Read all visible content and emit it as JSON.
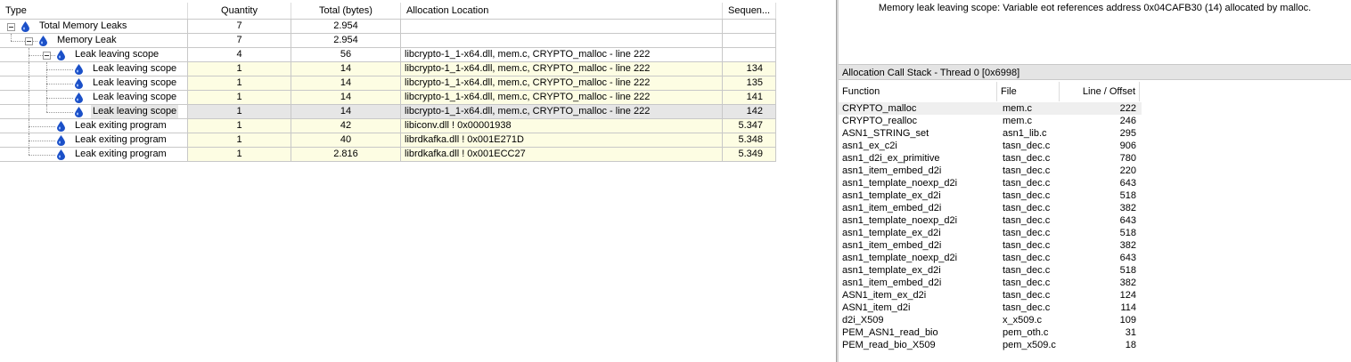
{
  "columns": {
    "type": "Type",
    "quantity": "Quantity",
    "total": "Total (bytes)",
    "location": "Allocation Location",
    "sequence": "Sequen..."
  },
  "rows": [
    {
      "label": "Total Memory Leaks",
      "quantity": "7",
      "total": "2.954",
      "location": "",
      "sequence": "",
      "highlight": false,
      "selected": false,
      "level": 0
    },
    {
      "label": "Memory Leak",
      "quantity": "7",
      "total": "2.954",
      "location": "",
      "sequence": "",
      "highlight": false,
      "selected": false,
      "level": 1
    },
    {
      "label": "Leak leaving scope",
      "quantity": "4",
      "total": "56",
      "location": "libcrypto-1_1-x64.dll, mem.c, CRYPTO_malloc - line 222",
      "sequence": "",
      "highlight": false,
      "selected": false,
      "level": 2
    },
    {
      "label": "Leak leaving scope",
      "quantity": "1",
      "total": "14",
      "location": "libcrypto-1_1-x64.dll, mem.c, CRYPTO_malloc - line 222",
      "sequence": "134",
      "highlight": true,
      "selected": false,
      "level": 3
    },
    {
      "label": "Leak leaving scope",
      "quantity": "1",
      "total": "14",
      "location": "libcrypto-1_1-x64.dll, mem.c, CRYPTO_malloc - line 222",
      "sequence": "135",
      "highlight": true,
      "selected": false,
      "level": 3
    },
    {
      "label": "Leak leaving scope",
      "quantity": "1",
      "total": "14",
      "location": "libcrypto-1_1-x64.dll, mem.c, CRYPTO_malloc - line 222",
      "sequence": "141",
      "highlight": true,
      "selected": false,
      "level": 3
    },
    {
      "label": "Leak leaving scope",
      "quantity": "1",
      "total": "14",
      "location": "libcrypto-1_1-x64.dll, mem.c, CRYPTO_malloc - line 222",
      "sequence": "142",
      "highlight": false,
      "selected": true,
      "level": 3
    },
    {
      "label": "Leak exiting program",
      "quantity": "1",
      "total": "42",
      "location": "libiconv.dll ! 0x00001938",
      "sequence": "5.347",
      "highlight": true,
      "selected": false,
      "level": 2
    },
    {
      "label": "Leak exiting program",
      "quantity": "1",
      "total": "40",
      "location": "librdkafka.dll ! 0x001E271D",
      "sequence": "5.348",
      "highlight": true,
      "selected": false,
      "level": 2
    },
    {
      "label": "Leak exiting program",
      "quantity": "1",
      "total": "2.816",
      "location": "librdkafka.dll ! 0x001ECC27",
      "sequence": "5.349",
      "highlight": true,
      "selected": false,
      "level": 2
    }
  ],
  "details": {
    "message": "Memory leak leaving scope: Variable eot references address 0x04CAFB30 (14) allocated by malloc."
  },
  "call_stack": {
    "title": "Allocation Call Stack - Thread 0 [0x6998]",
    "columns": {
      "function": "Function",
      "file": "File",
      "line": "Line / Offset"
    },
    "frames": [
      {
        "function": "CRYPTO_malloc",
        "file": "mem.c",
        "line": "222"
      },
      {
        "function": "CRYPTO_realloc",
        "file": "mem.c",
        "line": "246"
      },
      {
        "function": "ASN1_STRING_set",
        "file": "asn1_lib.c",
        "line": "295"
      },
      {
        "function": "asn1_ex_c2i",
        "file": "tasn_dec.c",
        "line": "906"
      },
      {
        "function": "asn1_d2i_ex_primitive",
        "file": "tasn_dec.c",
        "line": "780"
      },
      {
        "function": "asn1_item_embed_d2i",
        "file": "tasn_dec.c",
        "line": "220"
      },
      {
        "function": "asn1_template_noexp_d2i",
        "file": "tasn_dec.c",
        "line": "643"
      },
      {
        "function": "asn1_template_ex_d2i",
        "file": "tasn_dec.c",
        "line": "518"
      },
      {
        "function": "asn1_item_embed_d2i",
        "file": "tasn_dec.c",
        "line": "382"
      },
      {
        "function": "asn1_template_noexp_d2i",
        "file": "tasn_dec.c",
        "line": "643"
      },
      {
        "function": "asn1_template_ex_d2i",
        "file": "tasn_dec.c",
        "line": "518"
      },
      {
        "function": "asn1_item_embed_d2i",
        "file": "tasn_dec.c",
        "line": "382"
      },
      {
        "function": "asn1_template_noexp_d2i",
        "file": "tasn_dec.c",
        "line": "643"
      },
      {
        "function": "asn1_template_ex_d2i",
        "file": "tasn_dec.c",
        "line": "518"
      },
      {
        "function": "asn1_item_embed_d2i",
        "file": "tasn_dec.c",
        "line": "382"
      },
      {
        "function": "ASN1_item_ex_d2i",
        "file": "tasn_dec.c",
        "line": "124"
      },
      {
        "function": "ASN1_item_d2i",
        "file": "tasn_dec.c",
        "line": "114"
      },
      {
        "function": "d2i_X509",
        "file": "x_x509.c",
        "line": "109"
      },
      {
        "function": "PEM_ASN1_read_bio",
        "file": "pem_oth.c",
        "line": "31"
      },
      {
        "function": "PEM_read_bio_X509",
        "file": "pem_x509.c",
        "line": "18"
      }
    ]
  },
  "colors": {
    "highlight_row": "#fdfde3",
    "selected_row": "#e6e6e6",
    "drop_icon": "#1b50c8"
  },
  "icons": {
    "expander": "collapse-box-icon",
    "leak": "water-drop-icon"
  }
}
